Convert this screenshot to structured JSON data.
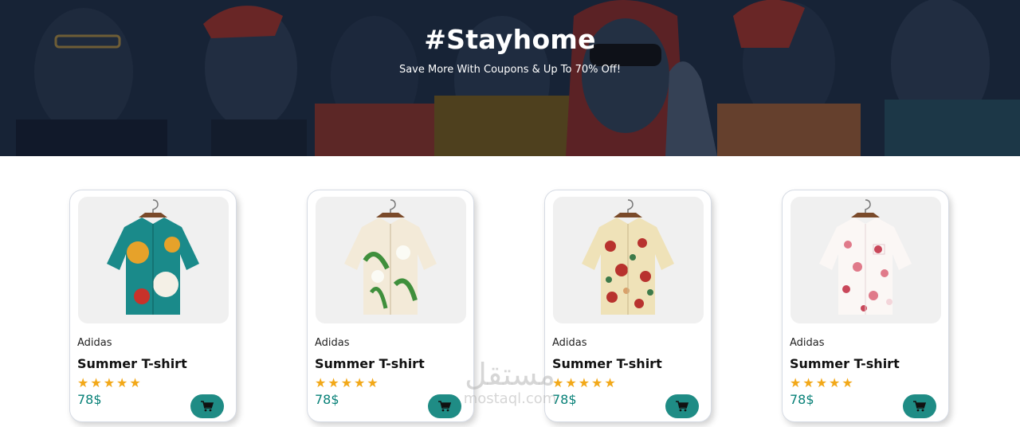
{
  "hero": {
    "title": "#Stayhome",
    "subtitle": "Save More With Coupons & Up To 70% Off!"
  },
  "products": [
    {
      "brand": "Adidas",
      "name": "Summer T-shirt",
      "rating": 5,
      "price": "78$",
      "shirt_colors": [
        "#1a8a8a",
        "#e6a22a",
        "#f4f0e6",
        "#c8322a"
      ]
    },
    {
      "brand": "Adidas",
      "name": "Summer T-shirt",
      "rating": 5,
      "price": "78$",
      "shirt_colors": [
        "#f3ead8",
        "#3f8f3c",
        "#fbfbf5",
        "#d8c8a8"
      ]
    },
    {
      "brand": "Adidas",
      "name": "Summer T-shirt",
      "rating": 5,
      "price": "78$",
      "shirt_colors": [
        "#efe2b8",
        "#b8322e",
        "#3d7a4a",
        "#d9a06a"
      ]
    },
    {
      "brand": "Adidas",
      "name": "Summer T-shirt",
      "rating": 5,
      "price": "78$",
      "shirt_colors": [
        "#fbf7f5",
        "#e07a8a",
        "#c9475a",
        "#f3d5da"
      ]
    }
  ],
  "icons": {
    "cart": "cart-icon",
    "star": "star-icon"
  },
  "colors": {
    "accent": "#088178",
    "cart_button": "#1f8c85",
    "star": "#f2a818",
    "hero_bg": "#1b2536"
  },
  "watermark": {
    "arabic": "مستقل",
    "latin": "mostaql.com"
  }
}
